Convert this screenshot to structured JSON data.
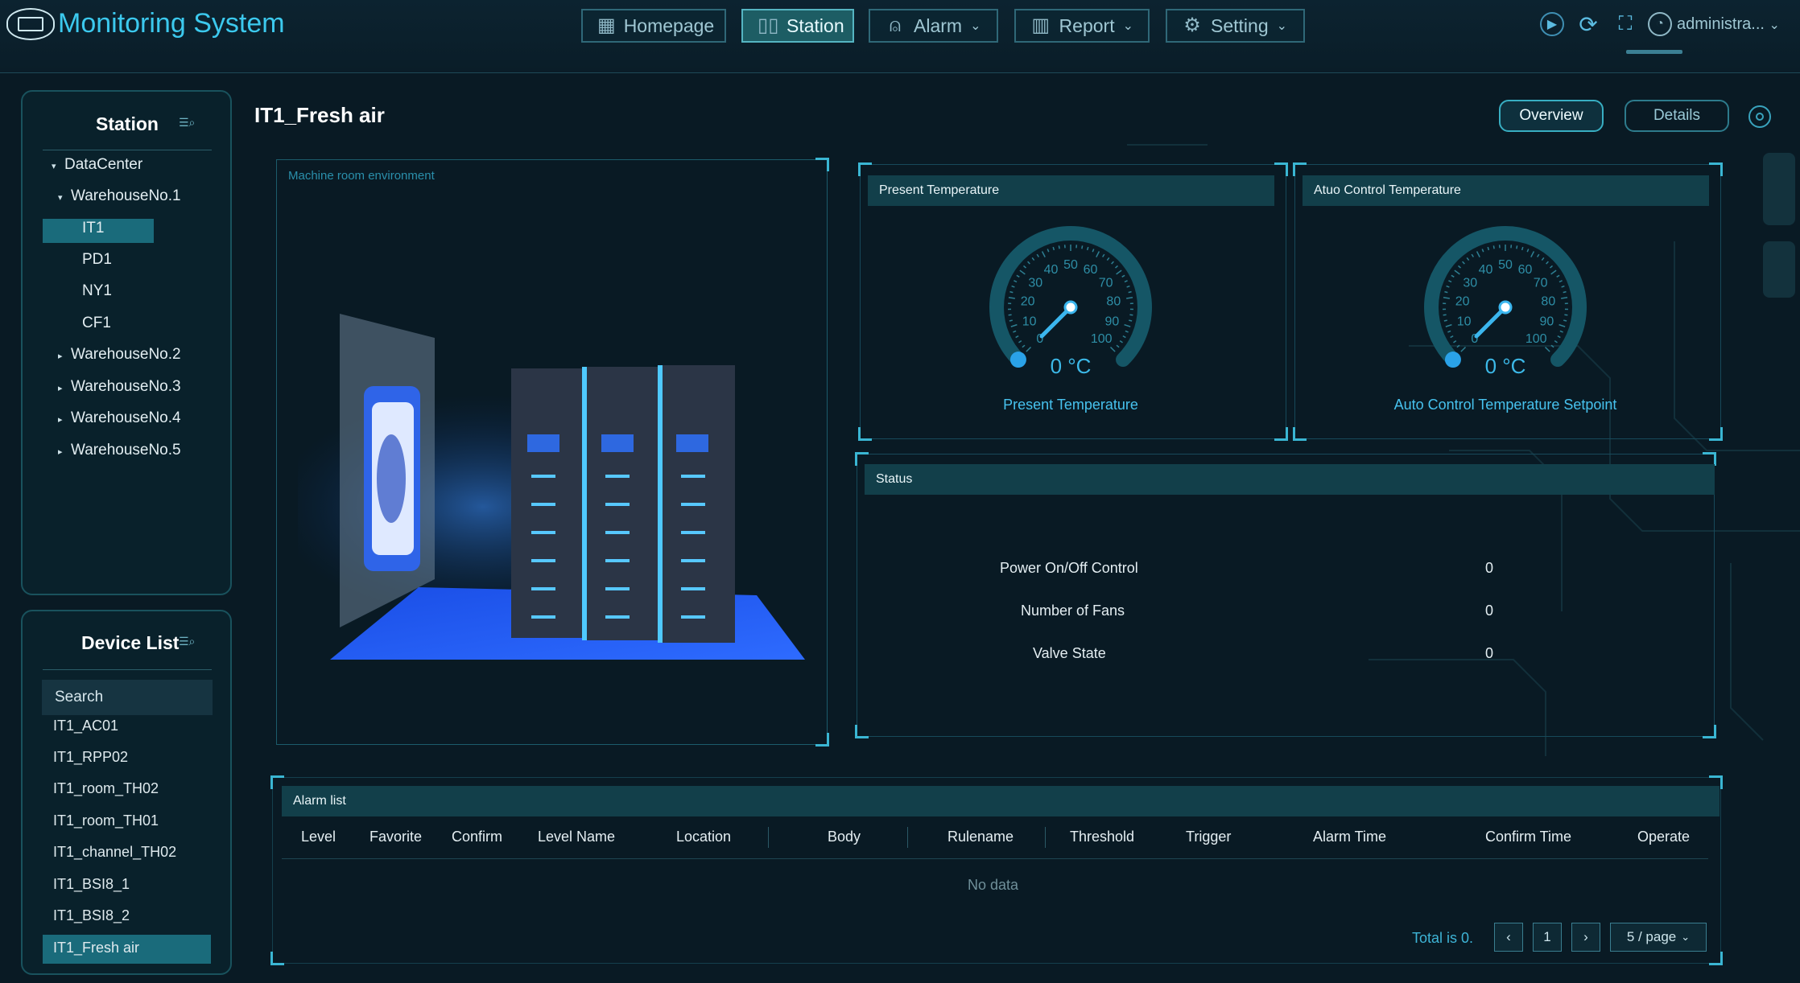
{
  "header": {
    "app_title": "Monitoring System",
    "nav": [
      {
        "label": "Homepage",
        "icon": "grid-icon",
        "dropdown": false
      },
      {
        "label": "Station",
        "icon": "station-icon",
        "dropdown": false
      },
      {
        "label": "Alarm",
        "icon": "bell-icon",
        "dropdown": true
      },
      {
        "label": "Report",
        "icon": "bar-chart-icon",
        "dropdown": true
      },
      {
        "label": "Setting",
        "icon": "gear-icon",
        "dropdown": true
      }
    ],
    "active_nav": "Station",
    "user": "administra..."
  },
  "station_panel": {
    "title": "Station",
    "tree": [
      {
        "label": "DataCenter",
        "arrow": "▾"
      },
      {
        "label": "WarehouseNo.1",
        "arrow": "▾"
      },
      {
        "label": "IT1",
        "arrow": ""
      },
      {
        "label": "PD1",
        "arrow": ""
      },
      {
        "label": "NY1",
        "arrow": ""
      },
      {
        "label": "CF1",
        "arrow": ""
      },
      {
        "label": "WarehouseNo.2",
        "arrow": "▸"
      },
      {
        "label": "WarehouseNo.3",
        "arrow": "▸"
      },
      {
        "label": "WarehouseNo.4",
        "arrow": "▸"
      },
      {
        "label": "WarehouseNo.5",
        "arrow": "▸"
      }
    ],
    "selected": "IT1"
  },
  "device_panel": {
    "title": "Device List",
    "search_placeholder": "Search",
    "devices": [
      "IT1_AC01",
      "IT1_RPP02",
      "IT1_room_TH02",
      "IT1_room_TH01",
      "IT1_channel_TH02",
      "IT1_BSI8_1",
      "IT1_BSI8_2",
      "IT1_Fresh air"
    ],
    "selected": "IT1_Fresh air"
  },
  "main": {
    "title": "IT1_Fresh air",
    "tabs": [
      "Overview",
      "Details"
    ],
    "active_tab": "Overview",
    "environment_caption": "Machine room environment",
    "gauges": [
      {
        "header": "Present Temperature",
        "reading": "0 °C",
        "caption": "Present Temperature",
        "value": 0,
        "ticks": [
          "0",
          "10",
          "20",
          "30",
          "40",
          "50",
          "60",
          "70",
          "80",
          "90",
          "100"
        ]
      },
      {
        "header": "Atuo Control Temperature",
        "reading": "0 °C",
        "caption": "Auto Control Temperature Setpoint",
        "value": 0,
        "ticks": [
          "0",
          "10",
          "20",
          "30",
          "40",
          "50",
          "60",
          "70",
          "80",
          "90",
          "100"
        ]
      }
    ],
    "status": {
      "header": "Status",
      "rows": [
        {
          "label": "Power On/Off Control",
          "value": "0"
        },
        {
          "label": "Number of Fans",
          "value": "0"
        },
        {
          "label": "Valve State",
          "value": "0"
        }
      ]
    },
    "alarm_list": {
      "header": "Alarm list",
      "columns": [
        "Level",
        "Favorite",
        "Confirm",
        "Level Name",
        "Location",
        "Body",
        "Rulename",
        "Threshold",
        "Trigger",
        "Alarm Time",
        "Confirm Time",
        "Operate"
      ],
      "empty_text": "No data",
      "total_text": "Total is 0.",
      "page": "1",
      "page_size": "5 / page"
    }
  },
  "colors": {
    "accent": "#3cc9ee",
    "selected_bg": "#1a6b7b",
    "background": "#091a24"
  }
}
